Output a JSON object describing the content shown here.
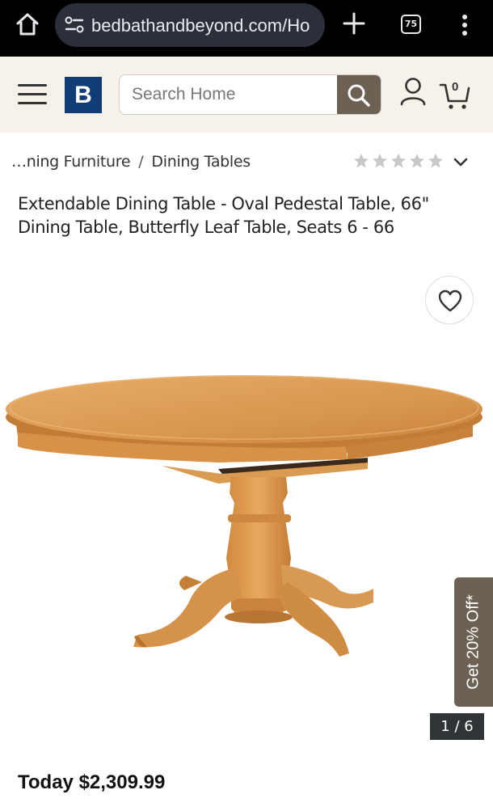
{
  "browser": {
    "url": "bedbathandbeyond.com/Ho",
    "tab_count": "75",
    "icons": [
      "home-icon",
      "site-info-icon",
      "new-tab-icon",
      "tab-switcher-icon",
      "more-menu-icon"
    ]
  },
  "header": {
    "logo_text": "B",
    "search_placeholder": "Search Home",
    "cart_count": "0",
    "colors": {
      "header_bg": "#f6f2ea",
      "logo_bg": "#123c75",
      "accent": "#6d6154"
    }
  },
  "breadcrumb": {
    "items": [
      "…ning Furniture",
      "Dining Tables"
    ],
    "separator": "/",
    "rating_stars": 0,
    "rating_max": 5
  },
  "product": {
    "title": "Extendable Dining Table - Oval Pedestal Table, 66\" Dining Table, Butterfly Leaf Table, Seats 6 - 66",
    "image_counter": "1 / 6",
    "promo_tab": "Get 20% Off*",
    "price": "Today $2,309.99"
  }
}
